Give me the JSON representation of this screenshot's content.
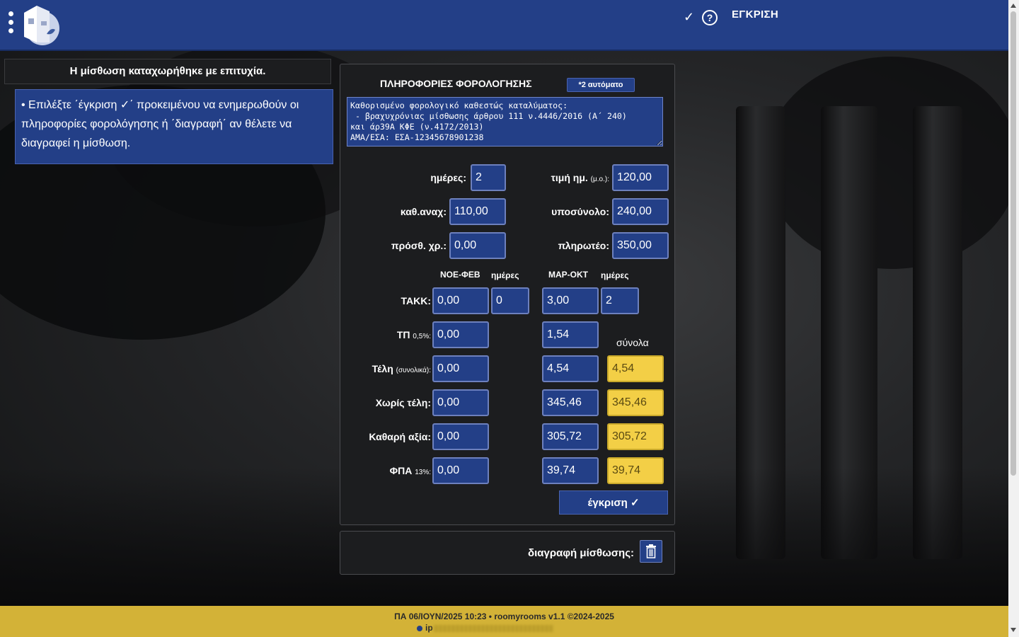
{
  "header": {
    "check_icon": "✓",
    "help_icon": "?",
    "approve_label": "ΕΓΚΡΙΣΗ"
  },
  "notices": {
    "success": "Η μίσθωση καταχωρήθηκε με επιτυχία.",
    "hint": "• Επιλέξτε ΄έγκριση ✓΄ προκειμένου να ενημερωθούν οι πληροφορίες φορολόγησης ή ΄διαγραφή΄ αν θέλετε να διαγραφεί η μίσθωση."
  },
  "panel": {
    "title": "ΠΛΗΡΟΦΟΡΙΕΣ ΦΟΡΟΛΟΓΗΣΗΣ",
    "auto_badge": "*2 αυτόματο",
    "tax_text": "Καθορισμένο φορολογικό καθεστώς καταλύματος:\n - βραχυχρόνιας μίσθωσης άρθρου 111 ν.4446/2016 (Α΄ 240)\nκαι άρ39Α ΚΦΕ (ν.4172/2013)\nΑΜΑ/ΕΣΑ: ΕΣΑ-12345678901238",
    "days_label": "ημέρες:",
    "days": "2",
    "price_label": "τιμή ημ.",
    "price_label_small": "(μ.ο.):",
    "price": "120,00",
    "cleaning_label": "καθ.αναχ:",
    "cleaning": "110,00",
    "subtotal_label": "υποσύνολο:",
    "subtotal": "240,00",
    "extra_label": "πρόσθ. χρ.:",
    "extra": "0,00",
    "payable_label": "πληρωτέο:",
    "payable": "350,00",
    "col_nov_feb": "ΝΟΕ-ΦΕΒ",
    "col_days1": "ημέρες",
    "col_mar_oct": "ΜΑΡ-ΟΚΤ",
    "col_days2": "ημέρες",
    "totals_label": "σύνολα",
    "rows": [
      {
        "label": "ΤΑΚΚ:",
        "small": "",
        "nov": "0,00",
        "nov_days": "0",
        "mar": "3,00",
        "mar_days": "2",
        "total": ""
      },
      {
        "label": "ΤΠ",
        "small": "0,5%:",
        "nov": "0,00",
        "nov_days": "",
        "mar": "1,54",
        "mar_days": "",
        "total": ""
      },
      {
        "label": "Τέλη",
        "small": "(συνολικά):",
        "nov": "0,00",
        "nov_days": "",
        "mar": "4,54",
        "mar_days": "",
        "total": "4,54"
      },
      {
        "label": "Χωρίς τέλη:",
        "small": "",
        "nov": "0,00",
        "nov_days": "",
        "mar": "345,46",
        "mar_days": "",
        "total": "345,46"
      },
      {
        "label": "Καθαρή αξία:",
        "small": "",
        "nov": "0,00",
        "nov_days": "",
        "mar": "305,72",
        "mar_days": "",
        "total": "305,72"
      },
      {
        "label": "ΦΠΑ",
        "small": "13%:",
        "nov": "0,00",
        "nov_days": "",
        "mar": "39,74",
        "mar_days": "",
        "total": "39,74"
      }
    ],
    "approve_button": "έγκριση ✓"
  },
  "delete": {
    "label": "διαγραφή μίσθωσης:",
    "icon": "trash-icon"
  },
  "footer": {
    "line1": "ΠΑ 06/ΙΟΥΝ/2025 10:23  • roomyrooms v1.1 ©2024-2025",
    "line2_prefix": "ip"
  },
  "colors": {
    "header_bg": "#233f87",
    "field_bg": "#233f87",
    "total_bg": "#f3cf46",
    "footer_bg": "#d3b237",
    "panel_bg": "#1c1d1f"
  }
}
